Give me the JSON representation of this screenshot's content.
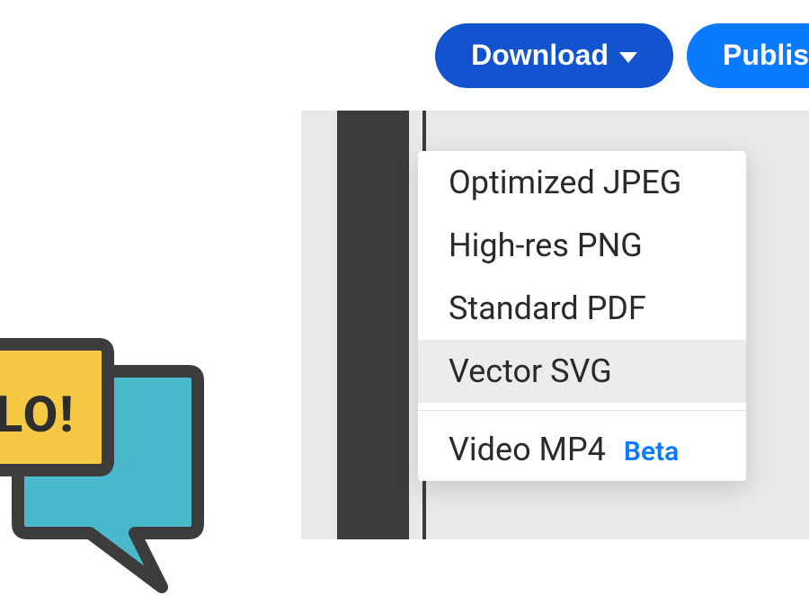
{
  "toolbar": {
    "download_label": "Download",
    "publish_label": "Publis"
  },
  "dropdown": {
    "items": [
      {
        "label": "Optimized JPEG",
        "selected": false
      },
      {
        "label": "High-res PNG",
        "selected": false
      },
      {
        "label": "Standard PDF",
        "selected": false
      },
      {
        "label": "Vector SVG",
        "selected": true
      }
    ],
    "extra": {
      "label": "Video MP4",
      "badge": "Beta"
    }
  },
  "canvas": {
    "bubble_text": "LO!"
  }
}
